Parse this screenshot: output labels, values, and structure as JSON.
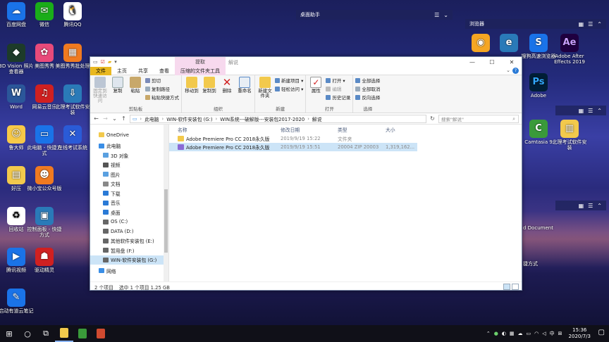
{
  "desktop": {
    "left_icons": [
      {
        "label": "百度网盘",
        "icon": "baidu-netdisk-icon",
        "glyph": "☁",
        "cls": "g-blue"
      },
      {
        "label": "微信",
        "icon": "wechat-icon",
        "glyph": "✉",
        "cls": "g-green"
      },
      {
        "label": "腾讯QQ",
        "icon": "qq-icon",
        "glyph": "🐧",
        "cls": "g-white"
      },
      {
        "label": "3D Vision 照片查看器",
        "icon": "3d-vision-icon",
        "glyph": "◆",
        "cls": "g-dark"
      },
      {
        "label": "美图秀秀",
        "icon": "meitu-icon",
        "glyph": "✿",
        "cls": "g-pink"
      },
      {
        "label": "美图秀秀批处理",
        "icon": "meitu-batch-icon",
        "glyph": "▦",
        "cls": "g-orange"
      },
      {
        "label": "Word",
        "icon": "word-icon",
        "glyph": "W",
        "cls": "g-word"
      },
      {
        "label": "网易云音乐",
        "icon": "netease-music-icon",
        "glyph": "♫",
        "cls": "g-red"
      },
      {
        "label": "北理考试软件安装",
        "icon": "exam-software-icon",
        "glyph": "⇩",
        "cls": "g-teal"
      },
      {
        "label": "鲁大师",
        "icon": "ludashi-icon",
        "glyph": "☺",
        "cls": "g-yellow"
      },
      {
        "label": "此电脑 - 快捷方式",
        "icon": "this-pc-icon",
        "glyph": "▭",
        "cls": "g-blue"
      },
      {
        "label": "在线考试系统",
        "icon": "online-exam-icon",
        "glyph": "✕",
        "cls": "g-win"
      },
      {
        "label": "好压",
        "icon": "haozip-icon",
        "glyph": "▤",
        "cls": "g-folder"
      },
      {
        "label": "微小宝公众号版",
        "icon": "weixiaobao-icon",
        "glyph": "☻",
        "cls": "g-orange"
      },
      {
        "label": "回收站",
        "icon": "recycle-bin-icon",
        "glyph": "♻",
        "cls": "g-white"
      },
      {
        "label": "控制面板 - 快捷方式",
        "icon": "control-panel-icon",
        "glyph": "▣",
        "cls": "g-teal"
      },
      {
        "label": "腾讯视频",
        "icon": "tencent-video-icon",
        "glyph": "▶",
        "cls": "g-blue"
      },
      {
        "label": "驱动精灵",
        "icon": "driver-genius-icon",
        "glyph": "☗",
        "cls": "g-red"
      },
      {
        "label": "启动有道云笔记",
        "icon": "youdao-note-icon",
        "glyph": "✎",
        "cls": "g-blue"
      }
    ],
    "right_icons": [
      {
        "label": "",
        "icon": "chrome-icon",
        "glyph": "◉",
        "cls": "g-star"
      },
      {
        "label": "",
        "icon": "ie-icon",
        "glyph": "e",
        "cls": "g-teal"
      },
      {
        "label": "搜狗高速浏览器",
        "icon": "sogou-browser-icon",
        "glyph": "S",
        "cls": "g-blue"
      },
      {
        "label": "Adobe After Effects 2019",
        "icon": "after-effects-icon",
        "glyph": "Ae",
        "cls": "g-ae"
      },
      {
        "label": "Adobe",
        "icon": "photoshop-icon",
        "glyph": "Ps",
        "cls": "g-ps"
      },
      {
        "label": "Camtasia 9",
        "icon": "camtasia-icon",
        "glyph": "C",
        "cls": "g-camt"
      },
      {
        "label": "北理考试软件安装",
        "icon": "exam-installer-icon",
        "glyph": "▥",
        "cls": "g-folder"
      }
    ],
    "widgets": {
      "assistant_title": "桌面助手",
      "browser_title": "浏览器",
      "partial_document": "d Document",
      "partial_shortcut": "捷方式"
    }
  },
  "explorer": {
    "context_tab": "提取",
    "window_title": "解说",
    "tabs": [
      "文件",
      "主页",
      "共享",
      "查看",
      "压缩的文件夹工具"
    ],
    "ribbon": {
      "clipboard": {
        "group": "剪贴板",
        "pin": "固定到快速访问",
        "copy": "复制",
        "paste": "粘贴",
        "cut": "剪切",
        "copy_path": "复制路径",
        "paste_shortcut": "粘贴快捷方式"
      },
      "organize": {
        "group": "组织",
        "move_to": "移动到",
        "copy_to": "复制到",
        "delete": "删除",
        "rename": "重命名"
      },
      "new": {
        "group": "新建",
        "new_folder": "新建文件夹",
        "new_item": "新建项目 ▾",
        "easy_access": "轻松访问 ▾"
      },
      "open": {
        "group": "打开",
        "properties": "属性",
        "open": "打开 ▾",
        "edit": "编辑",
        "history": "历史记录"
      },
      "select": {
        "group": "选择",
        "select_all": "全部选择",
        "select_none": "全部取消",
        "invert": "反向选择"
      }
    },
    "address": {
      "segments": [
        "此电脑",
        "WIN-软件安装包 (G:)",
        "WIN系统---破解版---安装包2017-2020",
        "解说"
      ],
      "separator": "›",
      "search_placeholder": "搜索\"解说\""
    },
    "nav_items": [
      {
        "label": "OneDrive",
        "icon": "onedrive-icon",
        "color": "#f2c94c",
        "sub": false
      },
      {
        "label": "此电脑",
        "icon": "computer-icon",
        "color": "#3a8ee6",
        "sub": false
      },
      {
        "label": "3D 对象",
        "icon": "3d-objects-icon",
        "color": "#5aa0e0",
        "sub": true
      },
      {
        "label": "视频",
        "icon": "videos-icon",
        "color": "#555",
        "sub": true
      },
      {
        "label": "图片",
        "icon": "pictures-icon",
        "color": "#5aa0e0",
        "sub": true
      },
      {
        "label": "文档",
        "icon": "documents-icon",
        "color": "#888",
        "sub": true
      },
      {
        "label": "下载",
        "icon": "downloads-icon",
        "color": "#2a7ad6",
        "sub": true
      },
      {
        "label": "音乐",
        "icon": "music-icon",
        "color": "#2a7ad6",
        "sub": true
      },
      {
        "label": "桌面",
        "icon": "desktop-icon",
        "color": "#2a7ad6",
        "sub": true
      },
      {
        "label": "OS (C:)",
        "icon": "drive-c-icon",
        "color": "#666",
        "sub": true
      },
      {
        "label": "DATA (D:)",
        "icon": "drive-d-icon",
        "color": "#666",
        "sub": true
      },
      {
        "label": "其他软件安装包 (E:)",
        "icon": "drive-e-icon",
        "color": "#666",
        "sub": true
      },
      {
        "label": "暂用盘 (F:)",
        "icon": "drive-f-icon",
        "color": "#666",
        "sub": true
      },
      {
        "label": "WIN-软件安装包 (G:)",
        "icon": "drive-g-icon",
        "color": "#666",
        "sub": true,
        "selected": true
      },
      {
        "label": "网络",
        "icon": "network-icon",
        "color": "#3a8ee6",
        "sub": false
      }
    ],
    "columns": [
      "名称",
      "修改日期",
      "类型",
      "大小"
    ],
    "files": [
      {
        "name": "Adobe Premiere Pro CC 2018永久版",
        "date": "2019/9/19 15:22",
        "type": "文件夹",
        "size": "",
        "icon": "folder-icon",
        "color": "#f2c94c",
        "selected": false
      },
      {
        "name": "Adobe Premiere Pro CC 2018永久版",
        "date": "2019/9/19 15:51",
        "type": "20004 ZIP 20003",
        "size": "1,319,162...",
        "icon": "zip-file-icon",
        "color": "#8a6ad6",
        "selected": true
      }
    ],
    "status": {
      "count": "2 个项目",
      "selection": "选中 1 个项目 1.25 GB"
    }
  },
  "taskbar": {
    "clock_time": "15:36",
    "clock_date": "2020/7/3",
    "ime": "中"
  }
}
